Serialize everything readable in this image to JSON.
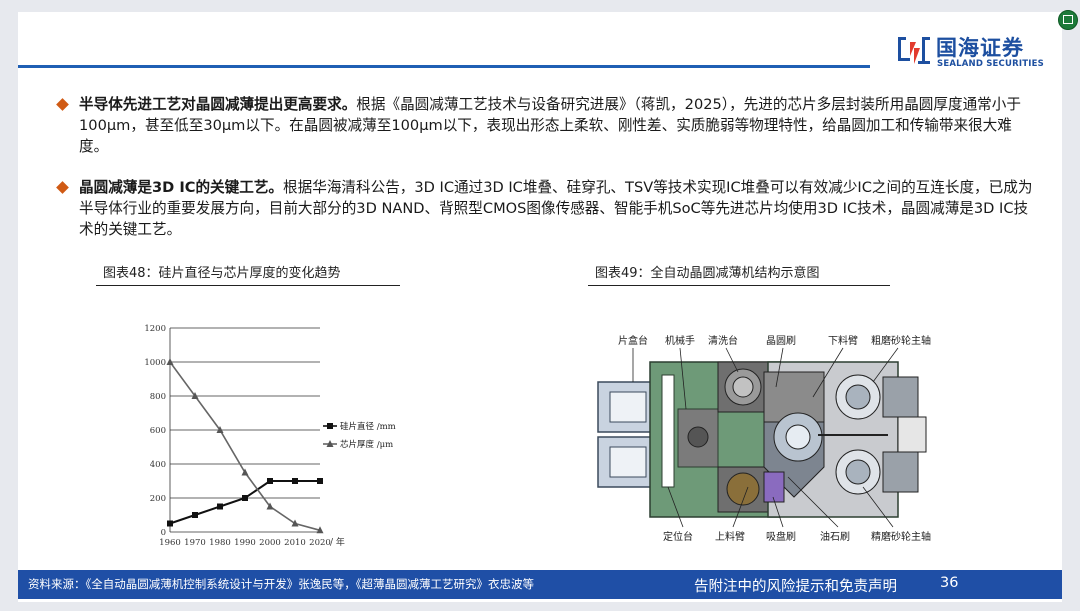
{
  "logo": {
    "name_cn": "国海证券",
    "name_en": "SEALAND SECURITIES",
    "brand_color": "#1d4fa0"
  },
  "bullets": [
    {
      "bold": "半导体先进工艺对晶圆减薄提出更高要求。",
      "text": "根据《晶圆减薄工艺技术与设备研究进展》（蒋凯，2025），先进的芯片多层封装所用晶圆厚度通常小于100μm，甚至低至30μm以下。在晶圆被减薄至100μm以下，表现出形态上柔软、刚性差、实质脆弱等物理特性，给晶圆加工和传输带来很大难度。"
    },
    {
      "bold": "晶圆减薄是3D IC的关键工艺。",
      "text": "根据华海清科公告，3D IC通过3D IC堆叠、硅穿孔、TSV等技术实现IC堆叠可以有效减少IC之间的互连长度，已成为半导体行业的重要发展方向，目前大部分的3D NAND、背照型CMOS图像传感器、智能手机SoC等先进芯片均使用3D IC技术，晶圆减薄是3D IC技术的关键工艺。"
    }
  ],
  "figure48": {
    "title": "图表48：硅片直径与芯片厚度的变化趋势"
  },
  "figure49": {
    "title": "图表49：全自动晶圆减薄机结构示意图",
    "labels_top": [
      "片盒台",
      "机械手",
      "清洗台",
      "晶圆刷",
      "下料臂",
      "粗磨砂轮主轴"
    ],
    "labels_bottom": [
      "定位台",
      "上料臂",
      "吸盘刷",
      "油石刷",
      "精磨砂轮主轴"
    ]
  },
  "chart_data": {
    "type": "line",
    "x": [
      1960,
      1970,
      1980,
      1990,
      2000,
      2010,
      2020
    ],
    "xlabel": "年",
    "x_unit_suffix": "/ 年",
    "ylim": [
      0,
      1200
    ],
    "yticks": [
      0,
      200,
      400,
      600,
      800,
      1000,
      1200
    ],
    "grid": true,
    "legend_position": "right",
    "series": [
      {
        "name": "硅片直径 /mm",
        "marker": "square",
        "values": [
          50,
          100,
          150,
          200,
          300,
          300,
          300
        ]
      },
      {
        "name": "芯片厚度 /μm",
        "marker": "triangle",
        "values": [
          1000,
          800,
          600,
          350,
          150,
          50,
          10
        ]
      }
    ]
  },
  "footer": {
    "source": "资料来源：《全自动晶圆减薄机控制系统设计与开发》张逸民等，《超薄晶圆减薄工艺研究》衣忠波等",
    "disclaimer": "告附注中的风险提示和免责声明",
    "page": "36"
  }
}
